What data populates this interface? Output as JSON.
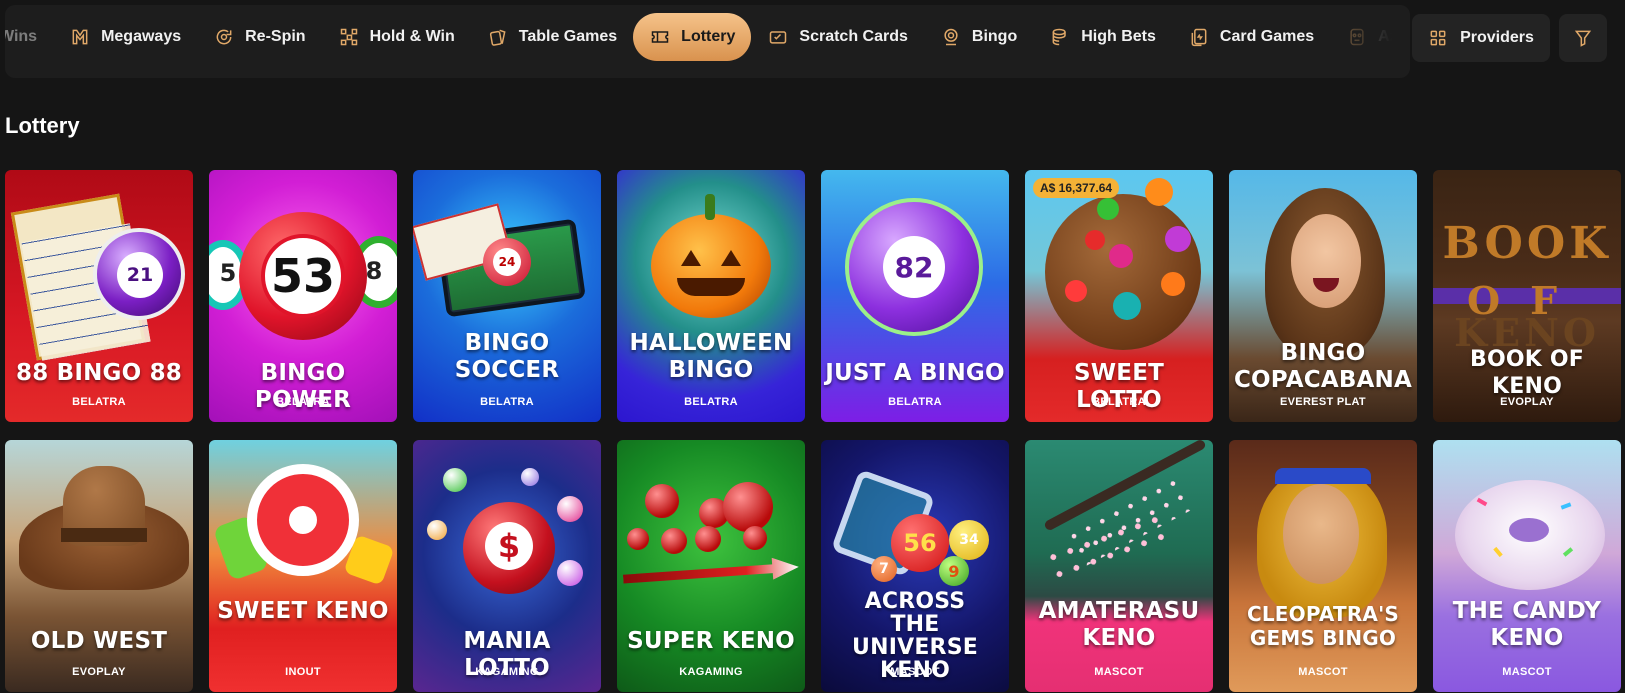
{
  "nav": {
    "categories": [
      {
        "label": "Wins",
        "icon": "trophy-icon",
        "state": "faded-left"
      },
      {
        "label": "Megaways",
        "icon": "megaways-icon"
      },
      {
        "label": "Re-Spin",
        "icon": "respin-icon"
      },
      {
        "label": "Hold & Win",
        "icon": "hold-win-icon"
      },
      {
        "label": "Table Games",
        "icon": "table-cards-icon"
      },
      {
        "label": "Lottery",
        "icon": "ticket-icon",
        "active": true
      },
      {
        "label": "Scratch Cards",
        "icon": "scratch-card-icon"
      },
      {
        "label": "Bingo",
        "icon": "bingo-icon"
      },
      {
        "label": "High Bets",
        "icon": "coins-icon"
      },
      {
        "label": "Card Games",
        "icon": "card-games-icon"
      },
      {
        "label": "Aztec",
        "icon": "aztec-mask-icon",
        "state": "faded-right"
      }
    ],
    "providers_label": "Providers",
    "accent_color": "#e0a868",
    "active_gradient": [
      "#f5c38a",
      "#d9924e"
    ]
  },
  "section": {
    "title": "Lottery"
  },
  "games": [
    {
      "name": "88 BINGO 88",
      "provider": "BELATRA"
    },
    {
      "name": "BINGO POWER",
      "provider": "BELATRA"
    },
    {
      "name": "BINGO SOCCER",
      "provider": "BELATRA"
    },
    {
      "name": "HALLOWEEN BINGO",
      "provider": "BELATRA"
    },
    {
      "name": "JUST A BINGO",
      "provider": "BELATRA"
    },
    {
      "name": "SWEET LOTTO",
      "provider": "BELATRA",
      "jackpot": "A$ 16,377.64"
    },
    {
      "name": "BINGO COPACABANA",
      "provider": "EVEREST PLAT"
    },
    {
      "name": "BOOK OF KENO",
      "provider": "EVOPLAY"
    },
    {
      "name": "OLD WEST",
      "provider": "EVOPLAY"
    },
    {
      "name": "SWEET KENO",
      "provider": "INOUT"
    },
    {
      "name": "MANIA LOTTO",
      "provider": "KAGAMING"
    },
    {
      "name": "SUPER KENO",
      "provider": "KAGAMING"
    },
    {
      "name": "ACROSS THE UNIVERSE KENO",
      "provider": "MASCOT"
    },
    {
      "name": "AMATERASU KENO",
      "provider": "MASCOT"
    },
    {
      "name": "CLEOPATRA'S GEMS BINGO",
      "provider": "MASCOT"
    },
    {
      "name": "THE CANDY KENO",
      "provider": "MASCOT"
    }
  ],
  "ball_numbers": {
    "bingo88": "21",
    "power": "53",
    "power_side_l": "5",
    "power_side_r": "8",
    "soccer": "24",
    "just": "82",
    "across": "56",
    "across2": "9",
    "across3": "7",
    "across4": "34"
  },
  "book_art_letters": [
    "B",
    "O",
    "O",
    "K",
    "O",
    "F",
    "K",
    "E",
    "N",
    "O"
  ]
}
